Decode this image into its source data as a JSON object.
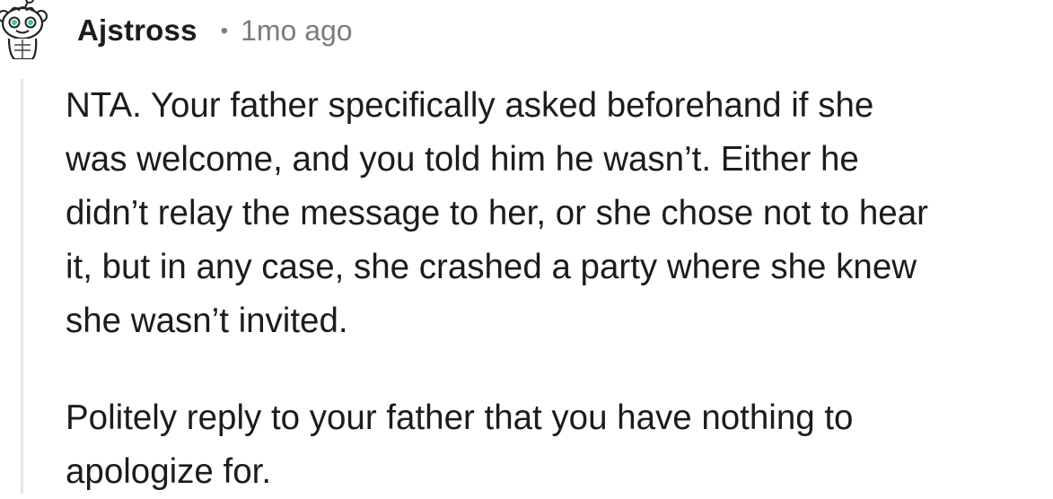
{
  "comment": {
    "author": "Ajstross",
    "separator": "•",
    "timestamp": "1mo ago",
    "avatar_icon": "snoo-avatar-icon",
    "paragraphs": [
      {
        "lines": [
          "NTA. Your father specifically asked beforehand if she",
          "was welcome, and you told him he wasn’t. Either he",
          "didn’t relay the message to her, or she chose not to hear",
          "it, but in any case, she crashed a party where she knew",
          "she wasn’t invited."
        ]
      },
      {
        "lines": [
          "Politely reply to your father that you have nothing to",
          "apologize for."
        ]
      }
    ]
  },
  "colors": {
    "text": "#1c1c1c",
    "meta": "#7c7c7c",
    "thread_line": "#e4e6e8",
    "avatar_accent": "#4fbf9f"
  }
}
